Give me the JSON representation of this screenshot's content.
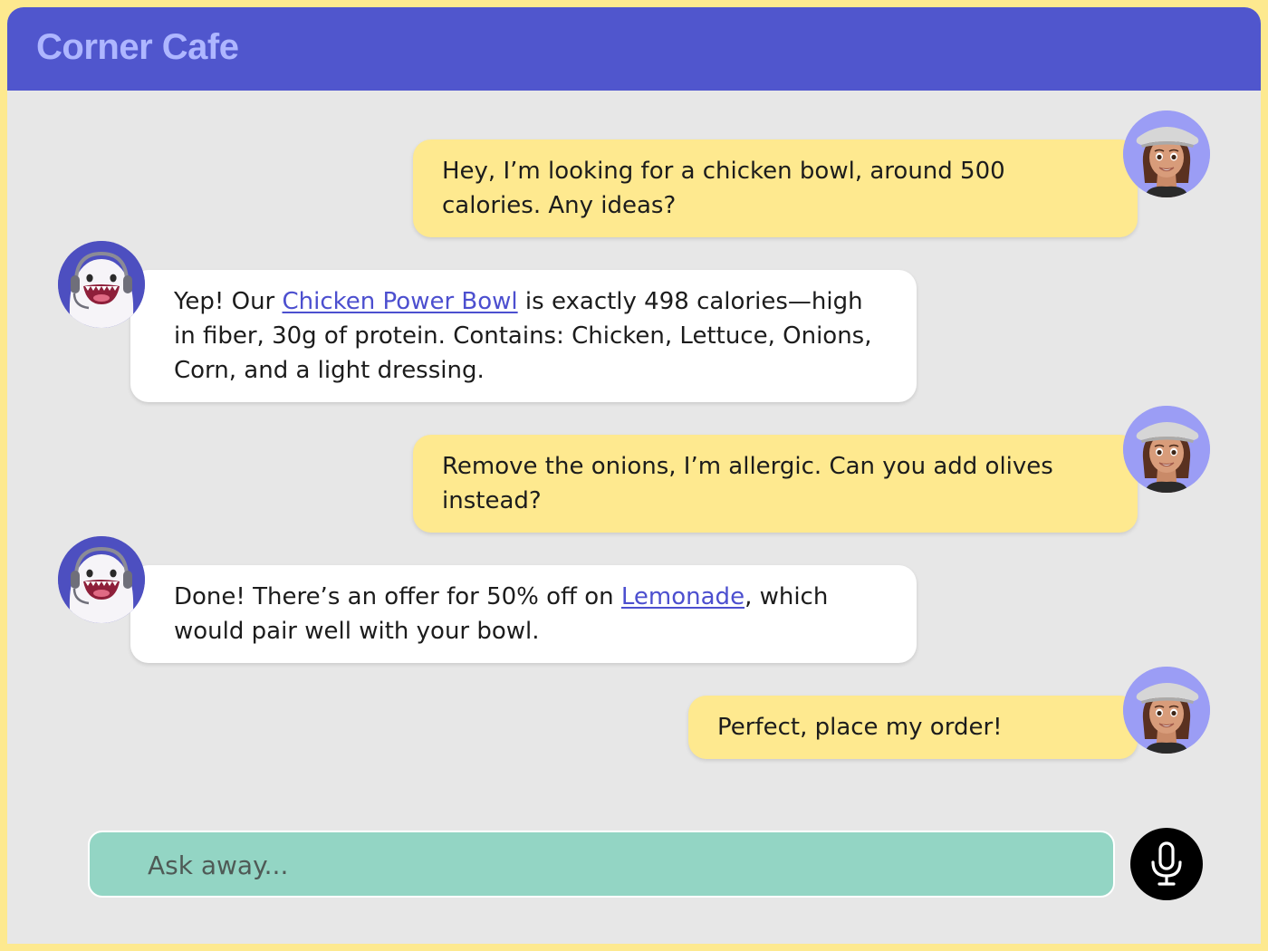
{
  "app": {
    "title": "Corner Cafe"
  },
  "messages": [
    {
      "sender": "user",
      "text": "Hey, I’m looking for a chicken bowl, around 500 calories. Any ideas?"
    },
    {
      "sender": "bot",
      "text_before": "Yep! Our ",
      "link": "Chicken Power Bowl",
      "text_after": " is exactly 498 calories—high in fiber, 30g of protein. Contains: Chicken, Lettuce, Onions, Corn, and a light dressing."
    },
    {
      "sender": "user",
      "text": "Remove the onions, I’m allergic. Can you add olives instead?"
    },
    {
      "sender": "bot",
      "text_before": "Done! There’s an offer for 50% off on ",
      "link": "Lemonade",
      "text_after": ", which would pair well with your bowl."
    },
    {
      "sender": "user",
      "text": "Perfect, place my order!"
    }
  ],
  "composer": {
    "placeholder": "Ask away...",
    "mic_icon": "microphone-icon"
  },
  "avatars": {
    "user": "user-avatar-memoji",
    "bot": "bot-mascot-with-headset"
  },
  "colors": {
    "header": "#5056cd",
    "title": "#aeb6ff",
    "frame": "#fde98f",
    "user_bubble": "#fee98f",
    "bot_bubble": "#ffffff",
    "link": "#4c4fcf",
    "input": "#93d5c4",
    "mic_button": "#000000"
  }
}
